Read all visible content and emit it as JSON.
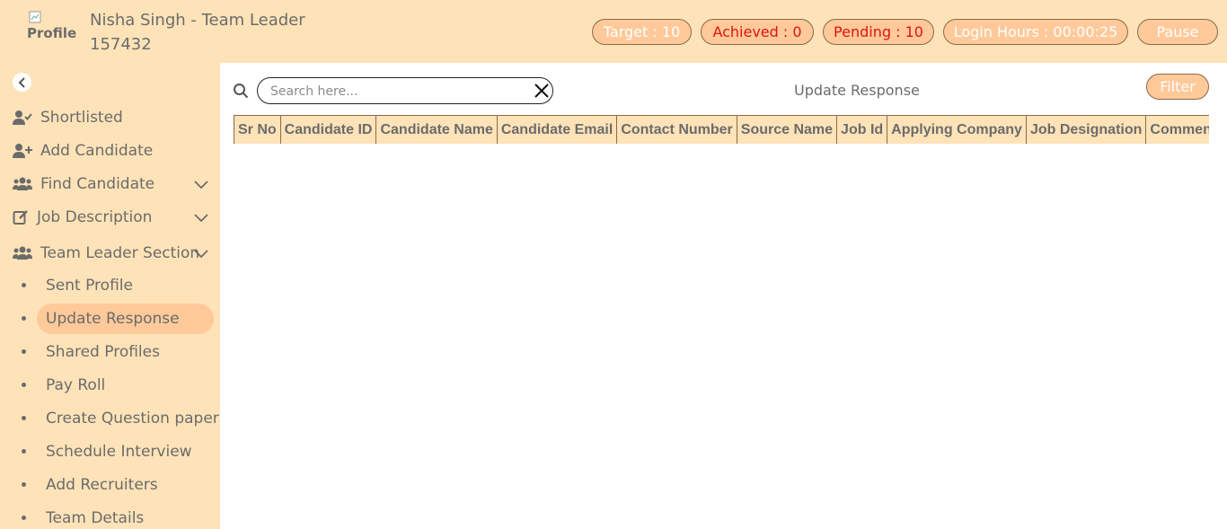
{
  "header": {
    "avatar_alt": "Profile",
    "user_name": "Nisha Singh - Team Leader",
    "user_id": "157432",
    "target": "Target : 10",
    "achieved": "Achieved : 0",
    "pending": "Pending : 10",
    "login_hours": "Login Hours : 00:00:25",
    "pause": "Pause"
  },
  "sidebar": {
    "items": [
      {
        "label": "Shortlisted",
        "icon": "user-check-icon"
      },
      {
        "label": "Add Candidate",
        "icon": "user-plus-icon"
      },
      {
        "label": "Find Candidate",
        "icon": "users-icon"
      },
      {
        "label": "Job Description",
        "icon": "edit-icon"
      },
      {
        "label": "Team Leader Section",
        "icon": "users-icon"
      }
    ],
    "sub_items": [
      {
        "label": "Sent Profile"
      },
      {
        "label": "Update Response",
        "active": true
      },
      {
        "label": "Shared Profiles"
      },
      {
        "label": "Pay Roll"
      },
      {
        "label": "Create Question paper"
      },
      {
        "label": "Schedule Interview"
      },
      {
        "label": "Add Recruiters"
      },
      {
        "label": "Team Details"
      }
    ]
  },
  "main": {
    "search_placeholder": "Search here...",
    "title": "Update Response",
    "filter": "Filter",
    "columns": [
      "Sr No",
      "Candidate ID",
      "Candidate Name",
      "Candidate Email",
      "Contact Number",
      "Source Name",
      "Job Id",
      "Applying Company",
      "Job Designation",
      "Comments"
    ]
  },
  "colors": {
    "header_bg": "#ffe3b8",
    "pill_bg": "#ffc99a",
    "alert_text": "#e0140c"
  }
}
